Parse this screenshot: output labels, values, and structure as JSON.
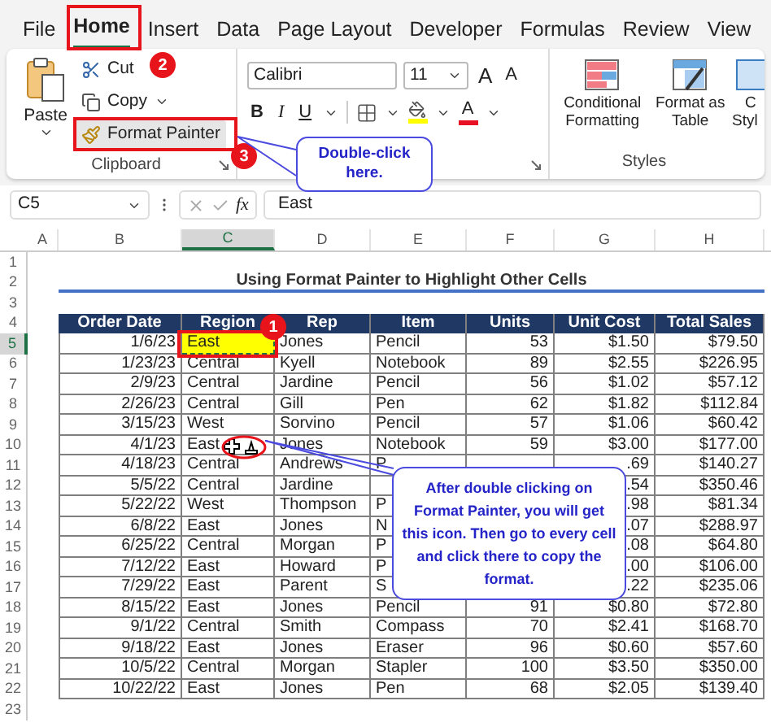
{
  "tabs": [
    {
      "label": "File",
      "selected": false
    },
    {
      "label": "Home",
      "selected": true
    },
    {
      "label": "Insert",
      "selected": false
    },
    {
      "label": "Data",
      "selected": false
    },
    {
      "label": "Page Layout",
      "selected": false
    },
    {
      "label": "Developer",
      "selected": false
    },
    {
      "label": "Formulas",
      "selected": false
    },
    {
      "label": "Review",
      "selected": false
    },
    {
      "label": "View",
      "selected": false
    }
  ],
  "ribbon": {
    "clipboard": {
      "paste": "Paste",
      "cut": "Cut",
      "copy": "Copy",
      "format_painter": "Format Painter",
      "label": "Clipboard"
    },
    "font": {
      "name": "Calibri",
      "size": "11",
      "grow": "A",
      "shrink": "A",
      "bold": "B",
      "italic": "I",
      "underline": "U",
      "font_color": "A"
    },
    "styles": {
      "conditional_formatting": "Conditional Formatting",
      "format_as_table": "Format as Table",
      "cell_styles_lines": [
        "C",
        "Styl"
      ],
      "label": "Styles"
    }
  },
  "formula_bar": {
    "name_box": "C5",
    "fx": "fx",
    "value": "East"
  },
  "column_headers": [
    {
      "label": "A",
      "selected": false
    },
    {
      "label": "B",
      "selected": false
    },
    {
      "label": "C",
      "selected": true
    },
    {
      "label": "D",
      "selected": false
    },
    {
      "label": "E",
      "selected": false
    },
    {
      "label": "F",
      "selected": false
    },
    {
      "label": "G",
      "selected": false
    },
    {
      "label": "H",
      "selected": false
    }
  ],
  "row_headers": [
    {
      "label": "1",
      "selected": false
    },
    {
      "label": "2",
      "selected": false
    },
    {
      "label": "3",
      "selected": false
    },
    {
      "label": "4",
      "selected": false
    },
    {
      "label": "5",
      "selected": true
    },
    {
      "label": "6",
      "selected": false
    },
    {
      "label": "7",
      "selected": false
    },
    {
      "label": "8",
      "selected": false
    },
    {
      "label": "9",
      "selected": false
    },
    {
      "label": "10",
      "selected": false
    },
    {
      "label": "11",
      "selected": false
    },
    {
      "label": "12",
      "selected": false
    },
    {
      "label": "13",
      "selected": false
    },
    {
      "label": "14",
      "selected": false
    },
    {
      "label": "15",
      "selected": false
    },
    {
      "label": "16",
      "selected": false
    },
    {
      "label": "17",
      "selected": false
    },
    {
      "label": "18",
      "selected": false
    },
    {
      "label": "19",
      "selected": false
    },
    {
      "label": "20",
      "selected": false
    },
    {
      "label": "21",
      "selected": false
    },
    {
      "label": "22",
      "selected": false
    },
    {
      "label": "23",
      "selected": false
    }
  ],
  "sheet": {
    "title": "Using Format Painter to Highlight Other Cells",
    "headers": [
      "Order Date",
      "Region",
      "Rep",
      "Item",
      "Units",
      "Unit Cost",
      "Total Sales"
    ],
    "rows": [
      {
        "cells": [
          "1/6/23",
          "East",
          "Jones",
          "Pencil",
          "53",
          "$1.50",
          "$79.50"
        ],
        "region_highlighted": true
      },
      {
        "cells": [
          "1/23/23",
          "Central",
          "Kyell",
          "Notebook",
          "89",
          "$2.55",
          "$226.95"
        ],
        "region_highlighted": false
      },
      {
        "cells": [
          "2/9/23",
          "Central",
          "Jardine",
          "Pencil",
          "56",
          "$1.02",
          "$57.12"
        ],
        "region_highlighted": false
      },
      {
        "cells": [
          "2/26/23",
          "Central",
          "Gill",
          "Pen",
          "62",
          "$1.82",
          "$112.84"
        ],
        "region_highlighted": false
      },
      {
        "cells": [
          "3/15/23",
          "West",
          "Sorvino",
          "Pencil",
          "57",
          "$1.06",
          "$60.42"
        ],
        "region_highlighted": false
      },
      {
        "cells": [
          "4/1/23",
          "East",
          "Jones",
          "Notebook",
          "59",
          "$3.00",
          "$177.00"
        ],
        "region_highlighted": false
      },
      {
        "cells": [
          "4/18/23",
          "Central",
          "Andrews",
          "P",
          null,
          ".69",
          "$140.27"
        ],
        "region_highlighted": false
      },
      {
        "cells": [
          "5/5/22",
          "Central",
          "Jardine",
          null,
          null,
          ".54",
          "$350.46"
        ],
        "region_highlighted": false
      },
      {
        "cells": [
          "5/22/22",
          "West",
          "Thompson",
          "P",
          null,
          ".98",
          "$81.34"
        ],
        "region_highlighted": false
      },
      {
        "cells": [
          "6/8/22",
          "East",
          "Jones",
          "N",
          null,
          ".07",
          "$288.97"
        ],
        "region_highlighted": false
      },
      {
        "cells": [
          "6/25/22",
          "Central",
          "Morgan",
          "P",
          null,
          ".08",
          "$64.80"
        ],
        "region_highlighted": false
      },
      {
        "cells": [
          "7/12/22",
          "East",
          "Howard",
          "P",
          null,
          ".00",
          "$106.00"
        ],
        "region_highlighted": false
      },
      {
        "cells": [
          "7/29/22",
          "East",
          "Parent",
          "S",
          null,
          ".22",
          "$235.06"
        ],
        "region_highlighted": false
      },
      {
        "cells": [
          "8/15/22",
          "East",
          "Jones",
          "Pencil",
          "91",
          "$0.80",
          "$72.80"
        ],
        "region_highlighted": false
      },
      {
        "cells": [
          "9/1/22",
          "Central",
          "Smith",
          "Compass",
          "70",
          "$2.41",
          "$168.70"
        ],
        "region_highlighted": false
      },
      {
        "cells": [
          "9/18/22",
          "East",
          "Jones",
          "Eraser",
          "96",
          "$0.60",
          "$57.60"
        ],
        "region_highlighted": false
      },
      {
        "cells": [
          "10/5/22",
          "Central",
          "Morgan",
          "Stapler",
          "100",
          "$3.50",
          "$350.00"
        ],
        "region_highlighted": false
      },
      {
        "cells": [
          "10/22/22",
          "East",
          "Jones",
          "Pen",
          "68",
          "$2.05",
          "$139.40"
        ],
        "region_highlighted": false
      }
    ]
  },
  "callouts": [
    {
      "text": "Double-click here."
    },
    {
      "text": "After double clicking on Format Painter, you will get this icon. Then go to every cell and click there to copy the format."
    }
  ],
  "steps": [
    "1",
    "2",
    "3"
  ]
}
